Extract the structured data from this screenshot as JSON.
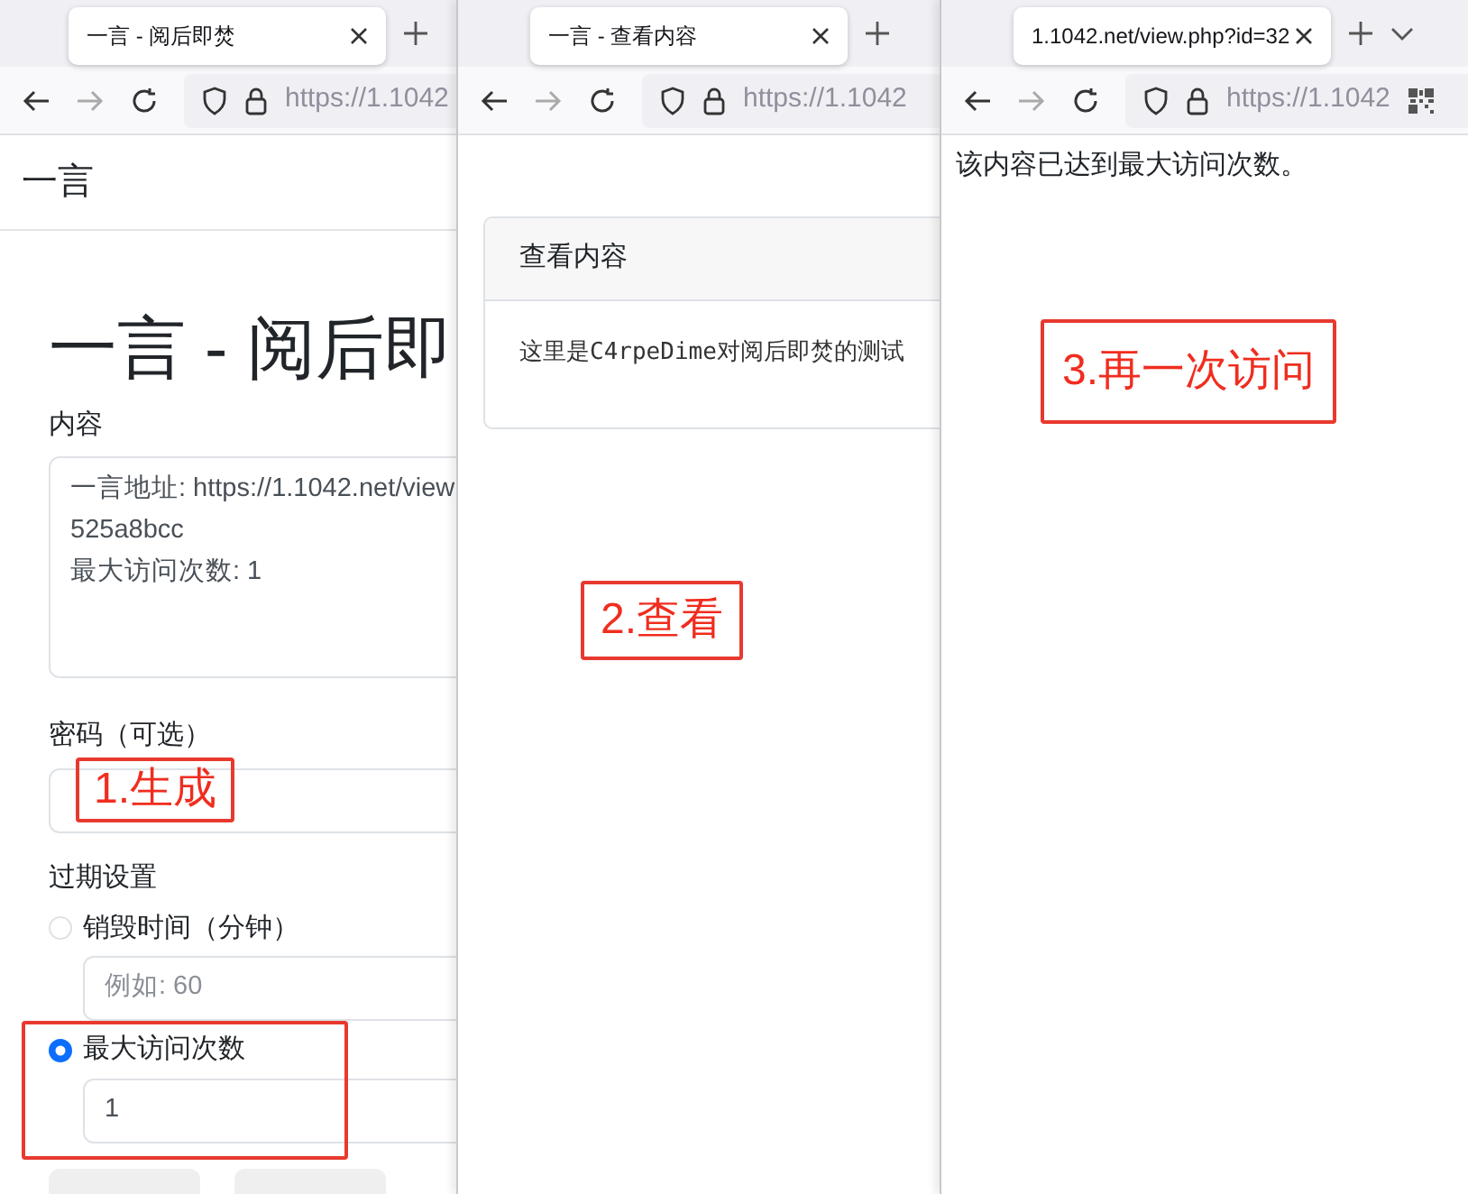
{
  "windows": [
    {
      "kind": "form",
      "tab": {
        "title": "一言 - 阅后即焚"
      },
      "url": "https://1.1042",
      "navbar_brand": "一言",
      "heading": "一言 - 阅后即",
      "content": {
        "label": "内容",
        "lines": [
          "一言地址: https://1.1042.net/view",
          "525a8bcc",
          "最大访问次数: 1"
        ]
      },
      "password": {
        "label": "密码（可选）"
      },
      "expiry": {
        "label": "过期设置",
        "options": [
          {
            "label": "销毁时间（分钟）",
            "selected": false,
            "placeholder": "例如: 60"
          },
          {
            "label": "最大访问次数",
            "selected": true,
            "value": "1"
          }
        ]
      },
      "annotation": "1.生成"
    },
    {
      "kind": "card",
      "tab": {
        "title": "一言 - 查看内容"
      },
      "url": "https://1.1042",
      "card": {
        "title": "查看内容",
        "body": "这里是C4rpeDime对阅后即焚的测试"
      },
      "annotation": "2.查看"
    },
    {
      "kind": "message",
      "tab": {
        "title": "1.1042.net/view.php?id=32"
      },
      "url": "https://1.1042",
      "message": "该内容已达到最大访问次数。",
      "annotation": "3.再一次访问"
    }
  ]
}
